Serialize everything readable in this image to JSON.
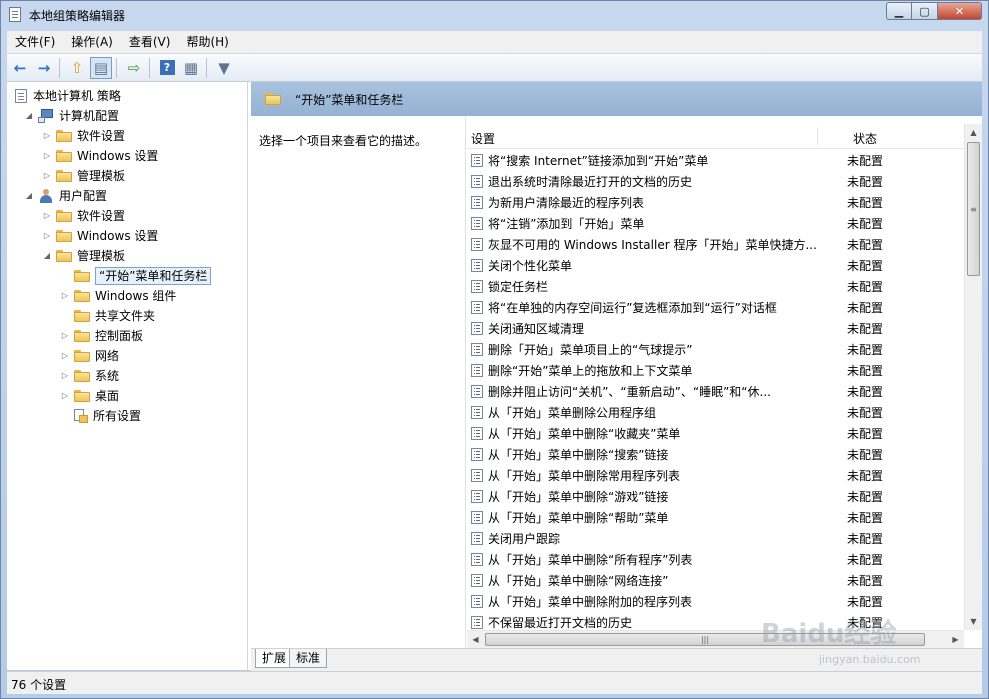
{
  "window": {
    "title": "本地组策略编辑器"
  },
  "menu": [
    "文件(F)",
    "操作(A)",
    "查看(V)",
    "帮助(H)"
  ],
  "toolbar": [
    {
      "name": "back-icon",
      "glyph": "←"
    },
    {
      "name": "forward-icon",
      "glyph": "→"
    },
    {
      "name": "up-folder-icon",
      "glyph": "⇧"
    },
    {
      "name": "show-hide-tree-icon",
      "glyph": "▤"
    },
    {
      "name": "export-list-icon",
      "glyph": "⇨"
    },
    {
      "name": "help-icon",
      "glyph": "?"
    },
    {
      "name": "properties-icon",
      "glyph": "▦"
    },
    {
      "name": "filter-icon",
      "glyph": "▼"
    }
  ],
  "tree": [
    {
      "label": "本地计算机 策略",
      "icon": "doc",
      "twisty": "",
      "indent": 0
    },
    {
      "label": "计算机配置",
      "icon": "pc",
      "twisty": "◢",
      "indent": 1
    },
    {
      "label": "软件设置",
      "icon": "folder",
      "twisty": "▷",
      "indent": 2
    },
    {
      "label": "Windows 设置",
      "icon": "folder",
      "twisty": "▷",
      "indent": 2
    },
    {
      "label": "管理模板",
      "icon": "folder",
      "twisty": "▷",
      "indent": 2
    },
    {
      "label": "用户配置",
      "icon": "user",
      "twisty": "◢",
      "indent": 1
    },
    {
      "label": "软件设置",
      "icon": "folder",
      "twisty": "▷",
      "indent": 2
    },
    {
      "label": "Windows 设置",
      "icon": "folder",
      "twisty": "▷",
      "indent": 2
    },
    {
      "label": "管理模板",
      "icon": "folder",
      "twisty": "◢",
      "indent": 2
    },
    {
      "label": "“开始”菜单和任务栏",
      "icon": "folder",
      "twisty": "",
      "indent": 3,
      "selected": true
    },
    {
      "label": "Windows 组件",
      "icon": "folder",
      "twisty": "▷",
      "indent": 3
    },
    {
      "label": "共享文件夹",
      "icon": "folder",
      "twisty": "",
      "indent": 3
    },
    {
      "label": "控制面板",
      "icon": "folder",
      "twisty": "▷",
      "indent": 3
    },
    {
      "label": "网络",
      "icon": "folder",
      "twisty": "▷",
      "indent": 3
    },
    {
      "label": "系统",
      "icon": "folder",
      "twisty": "▷",
      "indent": 3
    },
    {
      "label": "桌面",
      "icon": "folder",
      "twisty": "▷",
      "indent": 3
    },
    {
      "label": "所有设置",
      "icon": "all",
      "twisty": "",
      "indent": 3
    }
  ],
  "panel": {
    "title": "“开始”菜单和任务栏",
    "description": "选择一个项目来查看它的描述。",
    "col_setting": "设置",
    "col_state": "状态"
  },
  "settings": [
    {
      "name": "将“搜索 Internet”链接添加到“开始”菜单",
      "state": "未配置"
    },
    {
      "name": "退出系统时清除最近打开的文档的历史",
      "state": "未配置"
    },
    {
      "name": "为新用户清除最近的程序列表",
      "state": "未配置"
    },
    {
      "name": "将“注销”添加到「开始」菜单",
      "state": "未配置"
    },
    {
      "name": "灰显不可用的 Windows Installer 程序「开始」菜单快捷方...",
      "state": "未配置"
    },
    {
      "name": "关闭个性化菜单",
      "state": "未配置"
    },
    {
      "name": "锁定任务栏",
      "state": "未配置"
    },
    {
      "name": "将“在单独的内存空间运行”复选框添加到“运行”对话框",
      "state": "未配置"
    },
    {
      "name": "关闭通知区域清理",
      "state": "未配置"
    },
    {
      "name": "删除「开始」菜单项目上的“气球提示”",
      "state": "未配置"
    },
    {
      "name": "删除“开始”菜单上的拖放和上下文菜单",
      "state": "未配置"
    },
    {
      "name": "删除并阻止访问“关机”、“重新启动”、“睡眠”和“休...",
      "state": "未配置"
    },
    {
      "name": "从「开始」菜单删除公用程序组",
      "state": "未配置"
    },
    {
      "name": "从「开始」菜单中删除“收藏夹”菜单",
      "state": "未配置"
    },
    {
      "name": "从「开始」菜单中删除“搜索”链接",
      "state": "未配置"
    },
    {
      "name": "从「开始」菜单中删除常用程序列表",
      "state": "未配置"
    },
    {
      "name": "从「开始」菜单中删除“游戏”链接",
      "state": "未配置"
    },
    {
      "name": "从「开始」菜单中删除“帮助”菜单",
      "state": "未配置"
    },
    {
      "name": "关闭用户跟踪",
      "state": "未配置"
    },
    {
      "name": "从「开始」菜单中删除“所有程序”列表",
      "state": "未配置"
    },
    {
      "name": "从「开始」菜单中删除“网络连接”",
      "state": "未配置"
    },
    {
      "name": "从「开始」菜单中删除附加的程序列表",
      "state": "未配置"
    },
    {
      "name": "不保留最近打开文档的历史",
      "state": "未配置"
    }
  ],
  "tabs": [
    "扩展",
    "标准"
  ],
  "status": {
    "text": "76 个设置"
  },
  "watermark": {
    "logo": "Baidu经验",
    "sub": "jingyan.baidu.com"
  }
}
